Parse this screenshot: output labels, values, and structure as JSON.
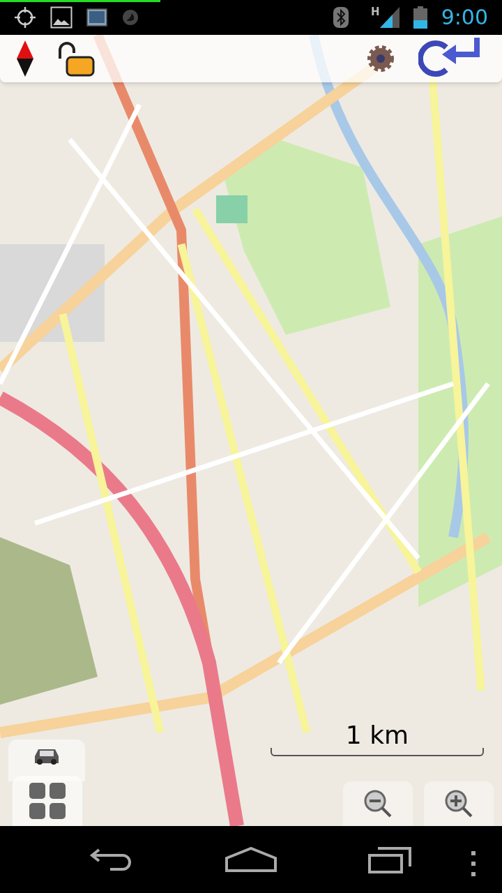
{
  "status_bar": {
    "progress": {
      "level": 0.32
    },
    "network": "H",
    "time": "9:00"
  },
  "map": {
    "scale": "1 km"
  }
}
